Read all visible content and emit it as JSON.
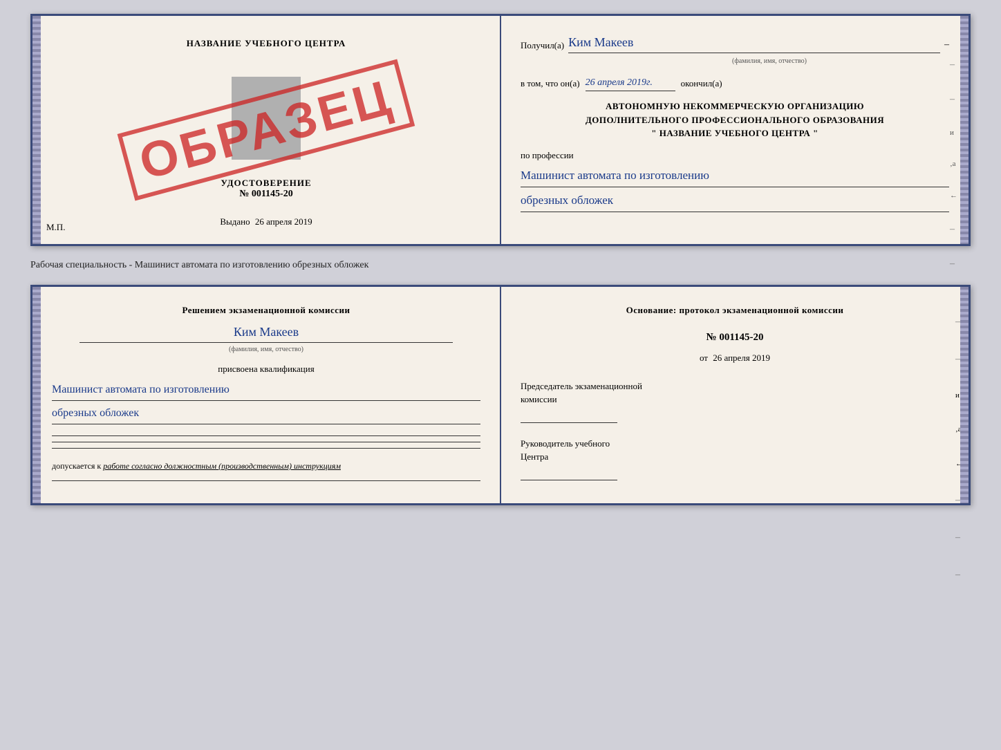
{
  "top_document": {
    "left": {
      "title": "НАЗВАНИЕ УЧЕБНОГО ЦЕНТРА",
      "stamp": "ОБРАЗЕЦ",
      "udostoverenie_label": "УДОСТОВЕРЕНИЕ",
      "number": "№ 001145-20",
      "vydano_label": "Выдано",
      "vydano_date": "26 апреля 2019",
      "mp_label": "М.П."
    },
    "right": {
      "poluchil_label": "Получил(а)",
      "recipient_name": "Ким Макеев",
      "fio_subtitle": "(фамилия, имя, отчество)",
      "dash": "–",
      "vtom_label": "в том, что он(а)",
      "completion_date": "26 апреля 2019г.",
      "okonchil_label": "окончил(а)",
      "org_line1": "АВТОНОМНУЮ НЕКОММЕРЧЕСКУЮ ОРГАНИЗАЦИЮ",
      "org_line2": "ДОПОЛНИТЕЛЬНОГО ПРОФЕССИОНАЛЬНОГО ОБРАЗОВАНИЯ",
      "org_quote": "\"   НАЗВАНИЕ УЧЕБНОГО ЦЕНТРА   \"",
      "po_professii_label": "по профессии",
      "profession_line1": "Машинист автомата по изготовлению",
      "profession_line2": "обрезных обложек"
    }
  },
  "caption": "Рабочая специальность - Машинист автомата по изготовлению обрезных обложек",
  "bottom_document": {
    "left": {
      "resheniem_label": "Решением экзаменационной комиссии",
      "person_name": "Ким Макеев",
      "fio_subtitle": "(фамилия, имя, отчество)",
      "prisvoena_label": "присвоена квалификация",
      "kvalif_line1": "Машинист автомата по изготовлению",
      "kvalif_line2": "обрезных обложек",
      "dopusk_label": "допускается к",
      "dopusk_text": "работе согласно должностным (производственным) инструкциям"
    },
    "right": {
      "osnovanie_label": "Основание: протокол экзаменационной комиссии",
      "protocol_number": "№  001145-20",
      "ot_label": "от",
      "protocol_date": "26 апреля 2019",
      "predsedatel_label": "Председатель экзаменационной",
      "komissia_label": "комиссии",
      "rukovoditel_label": "Руководитель учебного",
      "centra_label": "Центра"
    }
  }
}
